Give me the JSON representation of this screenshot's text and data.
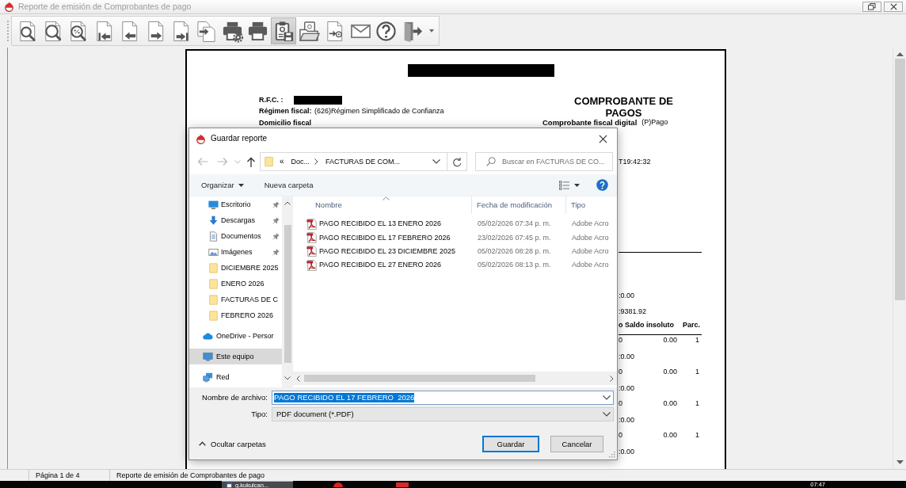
{
  "window": {
    "title": "Reporte de emisión de Comprobantes de pago"
  },
  "toolbar": {
    "buttons": [
      {
        "kind": "zoom",
        "pressed": false
      },
      {
        "kind": "zoom-fit",
        "pressed": false
      },
      {
        "kind": "zoom-percent",
        "pressed": false
      },
      {
        "kind": "first",
        "pressed": false
      },
      {
        "kind": "previous",
        "pressed": false
      },
      {
        "kind": "next",
        "pressed": false
      },
      {
        "kind": "last",
        "pressed": false
      },
      {
        "kind": "goto",
        "pressed": false
      },
      {
        "kind": "print-setup",
        "pressed": false
      },
      {
        "kind": "print",
        "pressed": false
      },
      {
        "kind": "save",
        "pressed": true
      },
      {
        "kind": "open",
        "pressed": false
      },
      {
        "kind": "send-mail",
        "pressed": false
      },
      {
        "kind": "mail",
        "pressed": false
      },
      {
        "kind": "help",
        "pressed": false
      },
      {
        "kind": "exit",
        "pressed": false
      }
    ]
  },
  "report_page": {
    "rfc_label": "R.F.C. :",
    "fiscal_regime_label": "Régimen fiscal:",
    "fiscal_regime": "(626)Régimen Simplificado de Confianza",
    "fiscal_address_label": "Domicilio fiscal",
    "heading": "COMPROBANTE DE PAGOS",
    "cfd_label": "Comprobante fiscal digital",
    "cfd_value": "(P)Pago",
    "timestamp_fragment": "T19:42:32",
    "summary": [
      ":0.00",
      ":9381.92"
    ],
    "table": {
      "columns": [
        "o",
        "Saldo insoluto",
        "Parc."
      ],
      "lines": [
        {
          "kind": "row",
          "cells": [
            "0",
            "0.00",
            "1"
          ]
        },
        {
          "kind": "fragment",
          "text": ":0.00"
        },
        {
          "kind": "row",
          "cells": [
            "0",
            "0.00",
            "1"
          ]
        },
        {
          "kind": "fragment",
          "text": ":0.00"
        },
        {
          "kind": "row",
          "cells": [
            "0",
            "0.00",
            "1"
          ]
        },
        {
          "kind": "fragment",
          "text": ":0.00"
        },
        {
          "kind": "row",
          "cells": [
            "0",
            "0.00",
            "1"
          ]
        },
        {
          "kind": "fragment",
          "text": ":0.00"
        }
      ]
    }
  },
  "save_dialog": {
    "title": "Guardar reporte",
    "path_overflow": "«",
    "path": [
      "Doc...",
      "FACTURAS DE COM..."
    ],
    "search": {
      "placeholder": "Buscar en FACTURAS DE CO..."
    },
    "commands": [
      {
        "label": "Organizar",
        "dropdown": true
      },
      {
        "label": "Nueva carpeta",
        "dropdown": false
      }
    ],
    "quick_access": [
      {
        "label": "Escritorio",
        "kind": "desktop",
        "pinned": true,
        "selected": false
      },
      {
        "label": "Descargas",
        "kind": "download",
        "pinned": true,
        "selected": false
      },
      {
        "label": "Documentos",
        "kind": "document",
        "pinned": true,
        "selected": false
      },
      {
        "label": "Imágenes",
        "kind": "pictures",
        "pinned": true,
        "selected": false
      },
      {
        "label": "DICIEMBRE 2025",
        "kind": "folder",
        "pinned": false,
        "selected": false
      },
      {
        "label": "ENERO 2026",
        "kind": "folder",
        "pinned": false,
        "selected": false
      },
      {
        "label": "FACTURAS DE C",
        "kind": "folder",
        "pinned": false,
        "selected": false
      },
      {
        "label": "FEBRERO 2026",
        "kind": "folder",
        "pinned": false,
        "selected": false
      }
    ],
    "locations": [
      {
        "label": "OneDrive - Persor",
        "kind": "cloud",
        "selected": false
      },
      {
        "label": "Este equipo",
        "kind": "computer",
        "selected": true
      },
      {
        "label": "Red",
        "kind": "network",
        "selected": false
      }
    ],
    "columns": [
      {
        "label": "Nombre",
        "sorted": true
      },
      {
        "label": "Fecha de modificación",
        "sorted": false
      },
      {
        "label": "Tipo",
        "sorted": false
      }
    ],
    "files": [
      {
        "name": "PAGO RECIBIDO EL 13 ENERO 2026",
        "modified": "05/02/2026 07:34 p. m.",
        "type": "Adobe Acro",
        "selected": false
      },
      {
        "name": "PAGO RECIBIDO EL 17 FEBRERO 2026",
        "modified": "23/02/2026 07:45 p. m.",
        "type": "Adobe Acro",
        "selected": false
      },
      {
        "name": "PAGO RECIBIDO EL 23 DICIEMBRE 2025",
        "modified": "05/02/2026 08:28 p. m.",
        "type": "Adobe Acro",
        "selected": false
      },
      {
        "name": "PAGO RECIBIDO EL 27 ENERO 2026",
        "modified": "05/02/2026 08:13 p. m.",
        "type": "Adobe Acro",
        "selected": false
      }
    ],
    "file_name": {
      "label": "Nombre de archivo:",
      "value": "PAGO RECIBIDO EL 17 FEBRERO  2026",
      "selected": true
    },
    "file_type": {
      "label": "Tipo:",
      "value": "PDF document (*.PDF)"
    },
    "folders_toggle": "Ocultar carpetas",
    "buttons": [
      {
        "label": "Guardar",
        "default": true
      },
      {
        "label": "Cancelar",
        "default": false
      }
    ]
  },
  "status_bar": {
    "page": "Página 1 de 4",
    "report": "Reporte de emisión de Comprobantes de pago"
  },
  "taskbar": {
    "items": [
      {
        "label": "g.kukulcan...",
        "active": true
      }
    ],
    "clock": "07:47"
  }
}
